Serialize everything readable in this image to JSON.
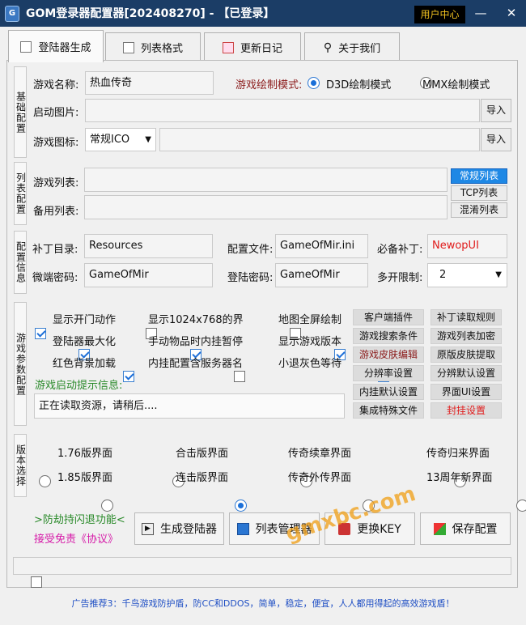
{
  "window": {
    "title": "GOM登录器配置器[202408270] - 【已登录】",
    "user_center": "用户中心",
    "min": "—",
    "max": "☐",
    "close": "✕"
  },
  "tabs": [
    {
      "label": "登陆器生成"
    },
    {
      "label": "列表格式"
    },
    {
      "label": "更新日记"
    },
    {
      "label": "关于我们"
    }
  ],
  "sections": {
    "basic": "基础配置",
    "list": "列表配置",
    "config": "配置信息",
    "params": "游戏参数配置",
    "version": "版本选择"
  },
  "basic": {
    "game_name_label": "游戏名称:",
    "game_name": "热血传奇",
    "draw_mode_label": "游戏绘制模式:",
    "d3d": "D3D绘制模式",
    "mmx": "MMX绘制模式",
    "start_img_label": "启动图片:",
    "import": "导入",
    "game_icon_label": "游戏图标:",
    "icon_select": "常规ICO"
  },
  "list": {
    "game_list_label": "游戏列表:",
    "backup_list_label": "备用列表:",
    "normal_list": "常规列表",
    "tcp_list": "TCP列表",
    "mixed_list": "混淆列表"
  },
  "config": {
    "patch_dir_label": "补丁目录:",
    "patch_dir": "Resources",
    "config_file_label": "配置文件:",
    "config_file": "GameOfMir.ini",
    "required_patch_label": "必备补丁:",
    "required_patch": "NewopUI",
    "micro_pwd_label": "微端密码:",
    "micro_pwd": "GameOfMir",
    "login_pwd_label": "登陆密码:",
    "login_pwd": "GameOfMir",
    "multi_limit_label": "多开限制:",
    "multi_limit": "2"
  },
  "params": {
    "checks": [
      {
        "label": "显示开门动作",
        "checked": true
      },
      {
        "label": "显示1024x768的界",
        "checked": false
      },
      {
        "label": "地图全屏绘制",
        "checked": false
      },
      {
        "label": "登陆器最大化",
        "checked": true
      },
      {
        "label": "手动物品时内挂暂停",
        "checked": true
      },
      {
        "label": "显示游戏版本",
        "checked": true
      },
      {
        "label": "红色背景加载",
        "checked": true
      },
      {
        "label": "内挂配置含服务器名",
        "checked": false
      },
      {
        "label": "小退灰色等待",
        "checked": true
      }
    ],
    "hint_label": "游戏启动提示信息:",
    "hint_text": "正在读取资源，请稍后....",
    "buttons": [
      "客户端插件",
      "补丁读取规则",
      "游戏搜索条件",
      "游戏列表加密",
      "游戏皮肤编辑",
      "原版皮肤提取",
      "分辨率设置",
      "分辨默认设置",
      "内挂默认设置",
      "界面UI设置",
      "集成特殊文件",
      "封挂设置"
    ]
  },
  "versions": [
    {
      "label": "1.76版界面",
      "on": false
    },
    {
      "label": "合击版界面",
      "on": false
    },
    {
      "label": "传奇续章界面",
      "on": false
    },
    {
      "label": "传奇归来界面",
      "on": false
    },
    {
      "label": "1.85版界面",
      "on": false
    },
    {
      "label": "连击版界面",
      "on": true
    },
    {
      "label": "传奇外传界面",
      "on": false
    },
    {
      "label": "13周年新界面",
      "on": false
    }
  ],
  "bottom": {
    "anti_hijack": ">防劫持闪退功能<",
    "accept": "接受免责《协议》",
    "gen": "生成登陆器",
    "list_mgr": "列表管理器",
    "change_key": "更换KEY",
    "save": "保存配置",
    "watermark": "gmxbc.com"
  },
  "ad": "广告推荐3：千鸟游戏防护盾，防CC和DDOS，简单，稳定，便宜，人人都用得起的高效游戏盾！",
  "colors": {
    "title_bg": "#1b3d66",
    "accent": "#1a6fd8",
    "red": "#e01b1b",
    "maroon": "#8b1a1a",
    "green": "#2a8a2a",
    "magenta": "#d61aa8"
  }
}
